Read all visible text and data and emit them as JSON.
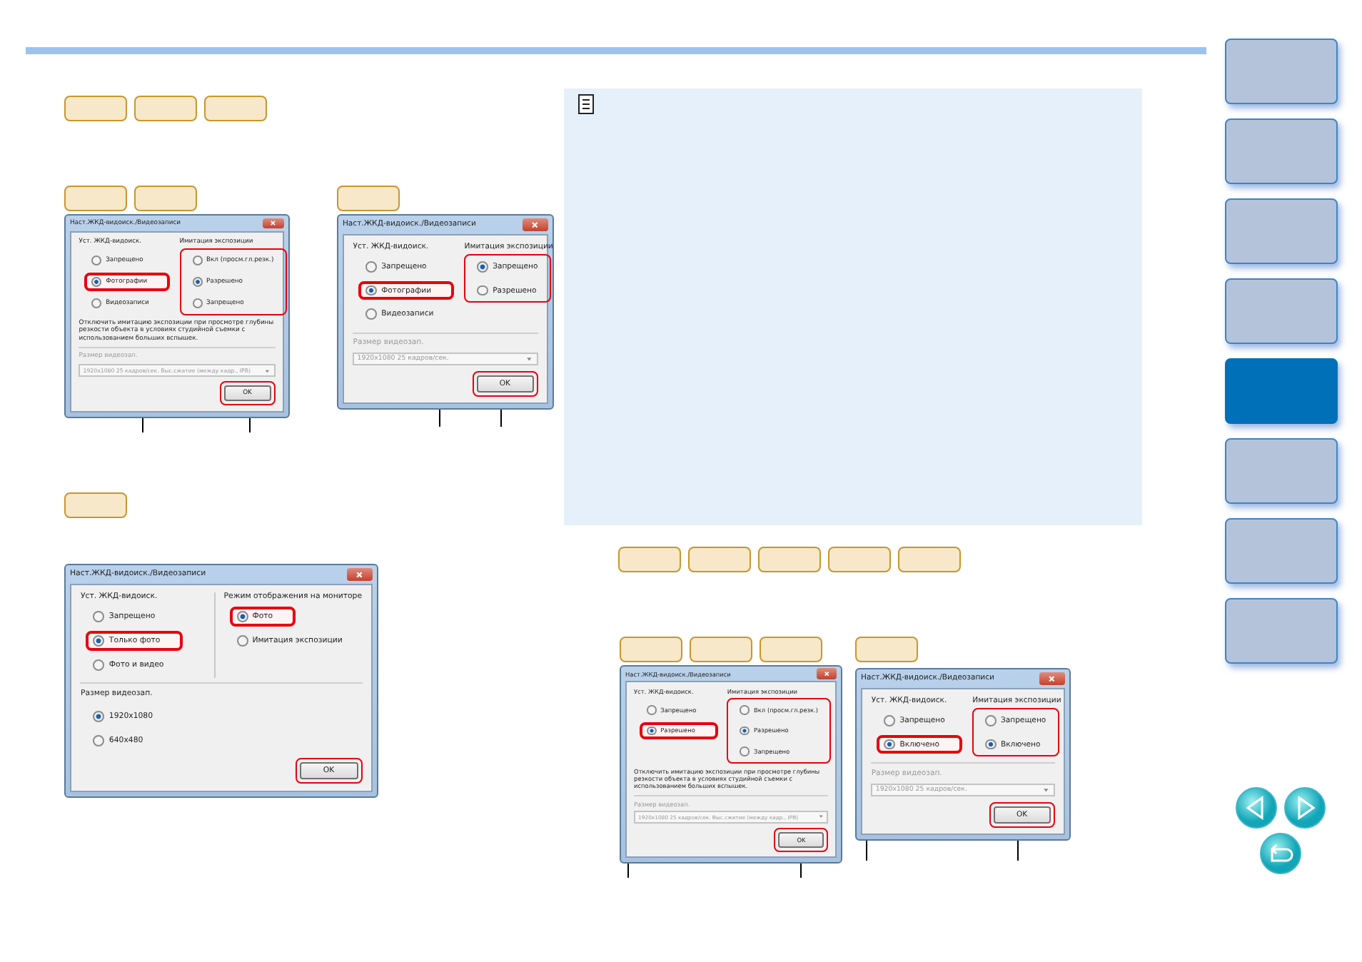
{
  "dialogs": [
    {
      "title": "Наст.ЖКД-видоиск./Видеозаписи",
      "groups": [
        {
          "label": "Уст. ЖКД-видоиск.",
          "highlighted": false,
          "options": [
            {
              "label": "Запрещено",
              "selected": false,
              "highlighted": false
            },
            {
              "label": "Фотографии",
              "selected": true,
              "highlighted": true
            },
            {
              "label": "Видеозаписи",
              "selected": false,
              "highlighted": false
            }
          ]
        },
        {
          "label": "Имитация экспозиции",
          "highlighted": true,
          "options": [
            {
              "label": "Вкл (просм.гл.резк.)",
              "selected": false,
              "highlighted": false
            },
            {
              "label": "Разрешено",
              "selected": true,
              "highlighted": false
            },
            {
              "label": "Запрещено",
              "selected": false,
              "highlighted": false
            }
          ]
        }
      ],
      "note": "Отключить имитацию экспозиции при просмотре глубины резкости объекта в условиях студийной съемки с использованием больших вспышек.",
      "size": {
        "label": "Размер видеозап.",
        "kind": "select",
        "value": "1920x1080  25 кадров/сек. Выс.сжатие (между кадр., IPB)"
      },
      "ok": {
        "label": "OK",
        "highlighted": true
      }
    },
    {
      "title": "Наст.ЖКД-видоиск./Видеозаписи",
      "groups": [
        {
          "label": "Уст. ЖКД-видоиск.",
          "highlighted": false,
          "options": [
            {
              "label": "Запрещено",
              "selected": false,
              "highlighted": false
            },
            {
              "label": "Фотографии",
              "selected": true,
              "highlighted": true
            },
            {
              "label": "Видеозаписи",
              "selected": false,
              "highlighted": false
            }
          ]
        },
        {
          "label": "Имитация экспозиции",
          "highlighted": true,
          "options": [
            {
              "label": "Запрещено",
              "selected": true,
              "highlighted": false
            },
            {
              "label": "Разрешено",
              "selected": false,
              "highlighted": false
            }
          ]
        }
      ],
      "size": {
        "label": "Размер видеозап.",
        "kind": "select",
        "value": "1920x1080  25 кадров/сек."
      },
      "ok": {
        "label": "OK",
        "highlighted": true
      }
    },
    {
      "title": "Наст.ЖКД-видоиск./Видеозаписи",
      "groups": [
        {
          "label": "Уст. ЖКД-видоиск.",
          "highlighted": false,
          "options": [
            {
              "label": "Запрещено",
              "selected": false,
              "highlighted": false
            },
            {
              "label": "Только фото",
              "selected": true,
              "highlighted": true
            },
            {
              "label": "Фото и видео",
              "selected": false,
              "highlighted": false
            }
          ]
        },
        {
          "label": "Режим отображения на мониторе",
          "highlighted": false,
          "options": [
            {
              "label": "Фото",
              "selected": true,
              "highlighted": true
            },
            {
              "label": "Имитация экспозиции",
              "selected": false,
              "highlighted": false
            }
          ]
        }
      ],
      "size": {
        "label": "Размер видеозап.",
        "kind": "radio",
        "options": [
          {
            "label": "1920x1080",
            "selected": true
          },
          {
            "label": "640x480",
            "selected": false
          }
        ]
      },
      "ok": {
        "label": "OK",
        "highlighted": true
      }
    },
    {
      "title": "Наст.ЖКД-видоиск./Видеозаписи",
      "groups": [
        {
          "label": "Уст. ЖКД-видоиск.",
          "highlighted": false,
          "options": [
            {
              "label": "Запрещено",
              "selected": false,
              "highlighted": false
            },
            {
              "label": "Разрешено",
              "selected": true,
              "highlighted": true
            }
          ]
        },
        {
          "label": "Имитация экспозиции",
          "highlighted": true,
          "options": [
            {
              "label": "Вкл (просм.гл.резк.)",
              "selected": false,
              "highlighted": false
            },
            {
              "label": "Разрешено",
              "selected": true,
              "highlighted": false
            },
            {
              "label": "Запрещено",
              "selected": false,
              "highlighted": false
            }
          ]
        }
      ],
      "note": "Отключить имитацию экспозиции при просмотре глубины резкости объекта в условиях студийной съемки с использованием больших вспышек.",
      "size": {
        "label": "Размер видеозап.",
        "kind": "select",
        "value": "1920x1080  25 кадров/сек. Выс.сжатие (между кадр., IPB)"
      },
      "ok": {
        "label": "OK",
        "highlighted": true
      }
    },
    {
      "title": "Наст.ЖКД-видоиск./Видеозаписи",
      "groups": [
        {
          "label": "Уст. ЖКД-видоиск.",
          "highlighted": false,
          "options": [
            {
              "label": "Запрещено",
              "selected": false,
              "highlighted": false
            },
            {
              "label": "Включено",
              "selected": true,
              "highlighted": true
            }
          ]
        },
        {
          "label": "Имитация экспозиции",
          "highlighted": true,
          "options": [
            {
              "label": "Запрещено",
              "selected": false,
              "highlighted": false
            },
            {
              "label": "Включено",
              "selected": true,
              "highlighted": false
            }
          ]
        }
      ],
      "size": {
        "label": "Размер видеозап.",
        "kind": "select",
        "value": "1920x1080  25 кадров/сек."
      },
      "ok": {
        "label": "OK",
        "highlighted": true
      }
    }
  ],
  "sidebar": {
    "tabs": [
      {
        "selected": false
      },
      {
        "selected": false
      },
      {
        "selected": false
      },
      {
        "selected": false
      },
      {
        "selected": true
      },
      {
        "selected": false
      },
      {
        "selected": false
      },
      {
        "selected": false
      }
    ]
  }
}
